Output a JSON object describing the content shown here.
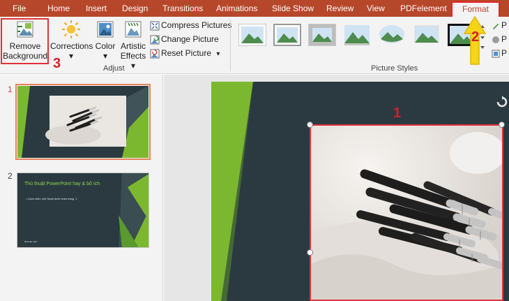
{
  "menu": {
    "tabs": [
      {
        "label": "File"
      },
      {
        "label": "Home"
      },
      {
        "label": "Insert"
      },
      {
        "label": "Design"
      },
      {
        "label": "Transitions"
      },
      {
        "label": "Animations"
      },
      {
        "label": "Slide Show"
      },
      {
        "label": "Review"
      },
      {
        "label": "View"
      },
      {
        "label": "PDFelement"
      },
      {
        "label": "Format"
      }
    ]
  },
  "ribbon": {
    "remove_background": {
      "line1": "Remove",
      "line2": "Background"
    },
    "corrections": {
      "label": "Corrections",
      "arrow": "▾"
    },
    "color": {
      "label": "Color",
      "arrow": "▾"
    },
    "artistic_effects": {
      "line1": "Artistic",
      "line2": "Effects",
      "arrow": "▾"
    },
    "compress_pictures": "Compress Pictures",
    "change_picture": "Change Picture",
    "reset_picture": "Reset Picture",
    "reset_arrow": "▾",
    "adjust_group_label": "Adjust",
    "picture_styles_group_label": "Picture Styles",
    "right_partial": [
      "P",
      "P",
      "P"
    ]
  },
  "annotations": {
    "step1": "1",
    "step2": "2",
    "step3": "3"
  },
  "slides": [
    {
      "number": "1"
    },
    {
      "number": "2",
      "title": "Thủ thuật PowerPoint hay & bổ ích",
      "bullet": "• Cách chèn chữ thuật dưới chân trang. 1",
      "footer": "Nhà sản xuất"
    }
  ],
  "colors": {
    "menubar": "#b7472a",
    "ribbon_bg": "#f3f3f3",
    "highlight_red": "#e0323a",
    "annotation_red": "#d3202a",
    "slide_bg": "#2b3a40",
    "accent_green": "#7cb82f",
    "arrow_yellow": "#f5d516"
  }
}
